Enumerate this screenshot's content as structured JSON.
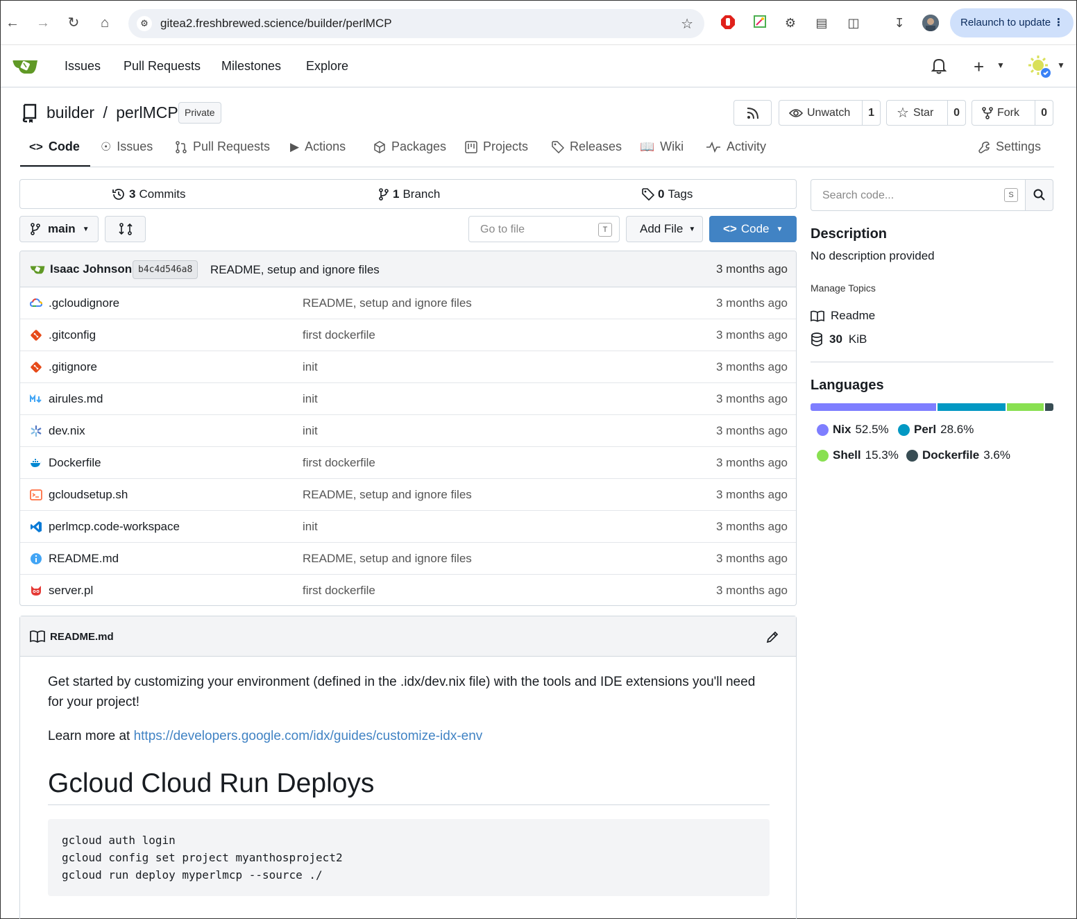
{
  "browser": {
    "url": "gitea2.freshbrewed.science/builder/perlMCP",
    "relaunch_label": "Relaunch to update"
  },
  "header": {
    "nav": [
      "Issues",
      "Pull Requests",
      "Milestones",
      "Explore"
    ]
  },
  "repo": {
    "owner": "builder",
    "separator": "/",
    "name": "perlMCP",
    "visibility": "Private",
    "watch_label": "Unwatch",
    "watch_count": "1",
    "star_label": "Star",
    "star_count": "0",
    "fork_label": "Fork",
    "fork_count": "0"
  },
  "tabs": [
    "Code",
    "Issues",
    "Pull Requests",
    "Actions",
    "Packages",
    "Projects",
    "Releases",
    "Wiki",
    "Activity",
    "Settings"
  ],
  "stats": {
    "commits_num": "3",
    "commits_label": "Commits",
    "branch_num": "1",
    "branch_label": "Branch",
    "tags_num": "0",
    "tags_label": "Tags"
  },
  "toolbar": {
    "branch": "main",
    "goto_placeholder": "Go to file",
    "goto_key": "T",
    "add_file": "Add File",
    "code": "Code"
  },
  "last_commit": {
    "author": "Isaac Johnson",
    "sha": "b4c4d546a8",
    "message": "README, setup and ignore files",
    "age": "3 months ago"
  },
  "files": [
    {
      "name": ".gcloudignore",
      "message": "README, setup and ignore files",
      "age": "3 months ago",
      "icon": "gcloud-icon"
    },
    {
      "name": ".gitconfig",
      "message": "first dockerfile",
      "age": "3 months ago",
      "icon": "git-icon"
    },
    {
      "name": ".gitignore",
      "message": "init",
      "age": "3 months ago",
      "icon": "git-icon"
    },
    {
      "name": "airules.md",
      "message": "init",
      "age": "3 months ago",
      "icon": "markdown-icon"
    },
    {
      "name": "dev.nix",
      "message": "init",
      "age": "3 months ago",
      "icon": "nix-icon"
    },
    {
      "name": "Dockerfile",
      "message": "first dockerfile",
      "age": "3 months ago",
      "icon": "docker-icon"
    },
    {
      "name": "gcloudsetup.sh",
      "message": "README, setup and ignore files",
      "age": "3 months ago",
      "icon": "shell-icon"
    },
    {
      "name": "perlmcp.code-workspace",
      "message": "init",
      "age": "3 months ago",
      "icon": "vscode-icon"
    },
    {
      "name": "README.md",
      "message": "README, setup and ignore files",
      "age": "3 months ago",
      "icon": "info-icon"
    },
    {
      "name": "server.pl",
      "message": "first dockerfile",
      "age": "3 months ago",
      "icon": "perl-icon"
    }
  ],
  "readme": {
    "filename": "README.md",
    "para1": "Get started by customizing your environment (defined in the .idx/dev.nix file) with the tools and IDE extensions you'll need for your project!",
    "learn_prefix": "Learn more at ",
    "learn_link": "https://developers.google.com/idx/guides/customize-idx-env",
    "heading": "Gcloud Cloud Run Deploys",
    "code": "gcloud auth login\ngcloud config set project myanthosproject2\ngcloud run deploy myperlmcp --source ./"
  },
  "sidebar": {
    "search_placeholder": "Search code...",
    "search_key": "S",
    "description_title": "Description",
    "description_text": "No description provided",
    "manage_topics": "Manage Topics",
    "readme_label": "Readme",
    "size_num": "30",
    "size_unit": "KiB",
    "languages_title": "Languages",
    "languages": [
      {
        "name": "Nix",
        "percent": "52.5%",
        "value": 52.5,
        "color": "#7e7eff"
      },
      {
        "name": "Perl",
        "percent": "28.6%",
        "value": 28.6,
        "color": "#0298c3"
      },
      {
        "name": "Shell",
        "percent": "15.3%",
        "value": 15.3,
        "color": "#89e051"
      },
      {
        "name": "Dockerfile",
        "percent": "3.6%",
        "value": 3.6,
        "color": "#384d54"
      }
    ]
  },
  "colors": {
    "primary": "#4183c4",
    "border": "#d0d7de",
    "text": "#181c21",
    "gitea_green": "#609926"
  }
}
